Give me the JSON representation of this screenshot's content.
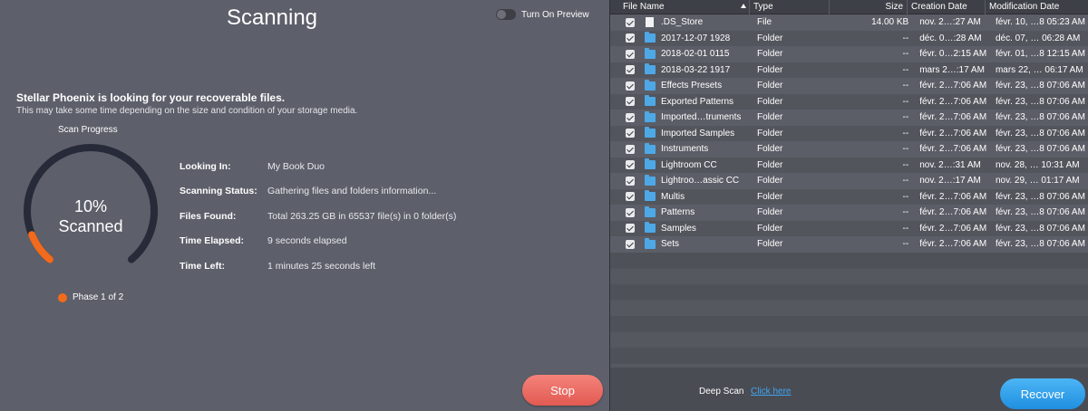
{
  "scan": {
    "title": "Scanning",
    "preview_label": "Turn On Preview",
    "headline": "Stellar Phoenix is looking for your recoverable files.",
    "subline": "This may take some time depending on the size and condition of your storage media.",
    "progress_label": "Scan Progress",
    "percent_text": "10%",
    "scanned_text": "Scanned",
    "progress_fraction": 0.1,
    "phase_text": "Phase 1 of 2",
    "accent_color": "#f26a1b",
    "info": [
      {
        "key": "Looking In:",
        "value": "My Book Duo"
      },
      {
        "key": "Scanning Status:",
        "value": "Gathering files and folders information..."
      },
      {
        "key": "Files Found:",
        "value": "Total 263.25 GB in 65537 file(s) in 0 folder(s)"
      },
      {
        "key": "Time Elapsed:",
        "value": "9 seconds elapsed"
      },
      {
        "key": "Time Left:",
        "value": "1 minutes 25 seconds left"
      }
    ],
    "stop_label": "Stop"
  },
  "table": {
    "headers": {
      "name": "File Name",
      "type": "Type",
      "size": "Size",
      "created": "Creation Date",
      "modified": "Modification Date"
    },
    "rows": [
      {
        "name": ".DS_Store",
        "icon": "file-icon",
        "type": "File",
        "size": "14.00 KB",
        "created": "nov. 2…:27 AM",
        "modified": "févr. 10, …8 05:23 AM"
      },
      {
        "name": "2017-12-07 1928",
        "icon": "folder-icon",
        "type": "Folder",
        "size": "--",
        "created": "déc. 0…:28 AM",
        "modified": "déc. 07, … 06:28 AM"
      },
      {
        "name": "2018-02-01 0115",
        "icon": "folder-icon",
        "type": "Folder",
        "size": "--",
        "created": "févr. 0…2:15 AM",
        "modified": "févr. 01, …8 12:15 AM"
      },
      {
        "name": "2018-03-22 1917",
        "icon": "folder-icon",
        "type": "Folder",
        "size": "--",
        "created": "mars 2…:17 AM",
        "modified": "mars 22, … 06:17 AM"
      },
      {
        "name": "Effects Presets",
        "icon": "folder-icon",
        "type": "Folder",
        "size": "--",
        "created": "févr. 2…7:06 AM",
        "modified": "févr. 23, …8 07:06 AM"
      },
      {
        "name": "Exported Patterns",
        "icon": "folder-icon",
        "type": "Folder",
        "size": "--",
        "created": "févr. 2…7:06 AM",
        "modified": "févr. 23, …8 07:06 AM"
      },
      {
        "name": "Imported…truments",
        "icon": "folder-icon",
        "type": "Folder",
        "size": "--",
        "created": "févr. 2…7:06 AM",
        "modified": "févr. 23, …8 07:06 AM"
      },
      {
        "name": "Imported Samples",
        "icon": "folder-icon",
        "type": "Folder",
        "size": "--",
        "created": "févr. 2…7:06 AM",
        "modified": "févr. 23, …8 07:06 AM"
      },
      {
        "name": "Instruments",
        "icon": "folder-icon",
        "type": "Folder",
        "size": "--",
        "created": "févr. 2…7:06 AM",
        "modified": "févr. 23, …8 07:06 AM"
      },
      {
        "name": "Lightroom CC",
        "icon": "folder-icon",
        "type": "Folder",
        "size": "--",
        "created": "nov. 2…:31 AM",
        "modified": "nov. 28, … 10:31 AM"
      },
      {
        "name": "Lightroo…assic CC",
        "icon": "folder-icon",
        "type": "Folder",
        "size": "--",
        "created": "nov. 2…:17 AM",
        "modified": "nov. 29, … 01:17 AM"
      },
      {
        "name": "Multis",
        "icon": "folder-icon",
        "type": "Folder",
        "size": "--",
        "created": "févr. 2…7:06 AM",
        "modified": "févr. 23, …8 07:06 AM"
      },
      {
        "name": "Patterns",
        "icon": "folder-icon",
        "type": "Folder",
        "size": "--",
        "created": "févr. 2…7:06 AM",
        "modified": "févr. 23, …8 07:06 AM"
      },
      {
        "name": "Samples",
        "icon": "folder-icon",
        "type": "Folder",
        "size": "--",
        "created": "févr. 2…7:06 AM",
        "modified": "févr. 23, …8 07:06 AM"
      },
      {
        "name": "Sets",
        "icon": "folder-icon",
        "type": "Folder",
        "size": "--",
        "created": "févr. 2…7:06 AM",
        "modified": "févr. 23, …8 07:06 AM"
      }
    ]
  },
  "footer": {
    "deep_scan_label": "Deep Scan",
    "click_here_label": "Click here",
    "recover_label": "Recover"
  }
}
